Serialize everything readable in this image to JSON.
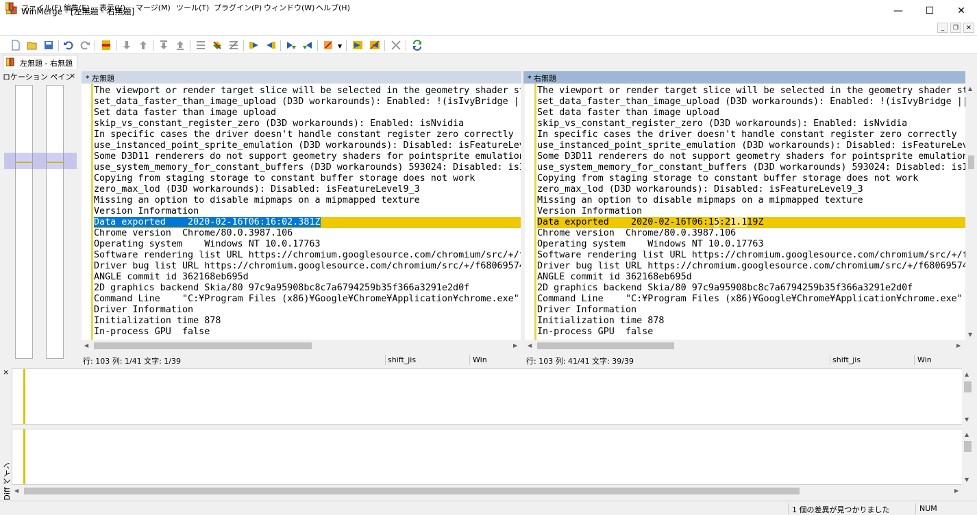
{
  "window": {
    "title": "WinMerge - [左無題 - 右無題]",
    "minimize": "—",
    "maximize": "☐",
    "close": "✕"
  },
  "menu": [
    "ファイル(F)",
    "編集(E)",
    "表示(V)",
    "マージ(M)",
    "ツール(T)",
    "プラグイン(P)",
    "ウィンドウ(W)",
    "ヘルプ(H)"
  ],
  "mdi": {
    "minimize": "_",
    "restore": "❐",
    "close": "✕"
  },
  "tab": {
    "label": "左無題 - 右無題"
  },
  "location_pane": {
    "title": "ロケーション ペイン",
    "close": "×"
  },
  "left": {
    "header": "* 左無題",
    "status": {
      "position": "行: 103  列: 1/41  文字: 1/39",
      "encoding": "shift_jis",
      "eol": "Win"
    }
  },
  "right": {
    "header": "* 右無題",
    "status": {
      "position": "行: 103  列: 41/41  文字: 39/39",
      "encoding": "shift_jis",
      "eol": "Win"
    }
  },
  "lines": [
    "The viewport or render target slice will be selected in the geometry shader st",
    "set_data_faster_than_image_upload (D3D workarounds): Enabled: !(isIvyBridge ||",
    "Set data faster than image upload",
    "skip_vs_constant_register_zero (D3D workarounds): Enabled: isNvidia",
    "In specific cases the driver doesn't handle constant register zero correctly",
    "use_instanced_point_sprite_emulation (D3D workarounds): Disabled: isFeatureLev",
    "Some D3D11 renderers do not support geometry shaders for pointsprite emulation",
    "use_system_memory_for_constant_buffers (D3D workarounds) 593024: Disabled: isI",
    "Copying from staging storage to constant buffer storage does not work",
    "zero_max_lod (D3D workarounds): Disabled: isFeatureLevel9_3",
    "Missing an option to disable mipmaps on a mipmapped texture",
    "Version Information",
    "__DIFF__",
    "Chrome version  Chrome/80.0.3987.106",
    "Operating system    Windows NT 10.0.17763",
    "Software rendering list URL https://chromium.googlesource.com/chromium/src/+/f",
    "Driver bug list URL https://chromium.googlesource.com/chromium/src/+/f68069574",
    "ANGLE commit id 362168eb695d",
    "2D graphics backend Skia/80 97c9a95908bc8c7a6794259b35f366a3291e2d0f",
    "Command Line    \"C:¥Program Files (x86)¥Google¥Chrome¥Application¥chrome.exe\"",
    "Driver Information",
    "Initialization time 878",
    "In-process GPU  false"
  ],
  "diff_line": {
    "left": "Data exported    2020-02-16T06:16:02.381Z",
    "right_prefix": "Data exported    2020-02-16T06:1",
    "right_hl1": "5",
    "right_mid": ":2",
    "right_hl2": "1.1",
    "right_suffix": "19Z"
  },
  "diff_pane": {
    "title": "Diff ペイン",
    "close": "×"
  },
  "statusbar": {
    "message": "1 個の差異が見つかりました",
    "num": "NUM"
  },
  "colors": {
    "diff": "#efc800",
    "selection": "#0078d7",
    "header_active": "#9fb6d4",
    "header": "#cfd8e6"
  }
}
